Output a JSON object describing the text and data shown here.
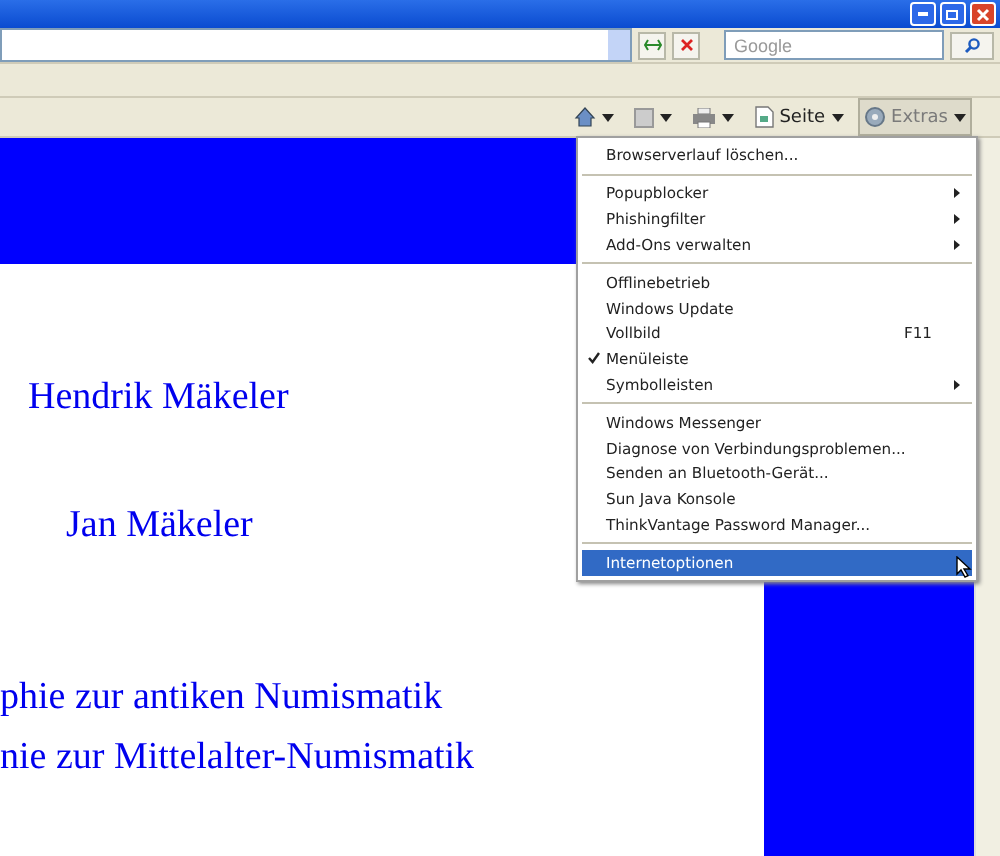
{
  "search": {
    "placeholder": "Google"
  },
  "command_bar": [
    {
      "kind": "home"
    },
    {
      "kind": "feeds"
    },
    {
      "kind": "print"
    },
    {
      "kind": "page",
      "label": "Seite"
    },
    {
      "kind": "tools",
      "label": "Extras"
    }
  ],
  "menu": [
    {
      "kind": "item",
      "label": "Browserverlauf löschen...",
      "submenu": false,
      "checked": false,
      "selected": false
    },
    {
      "kind": "separator"
    },
    {
      "kind": "item",
      "label": "Popupblocker",
      "submenu": true,
      "checked": false,
      "selected": false
    },
    {
      "kind": "item",
      "label": "Phishingfilter",
      "submenu": true,
      "checked": false,
      "selected": false
    },
    {
      "kind": "item",
      "label": "Add-Ons verwalten",
      "submenu": true,
      "checked": false,
      "selected": false
    },
    {
      "kind": "separator"
    },
    {
      "kind": "item",
      "label": "Offlinebetrieb",
      "submenu": false,
      "checked": false,
      "selected": false
    },
    {
      "kind": "item",
      "label": "Windows Update",
      "submenu": false,
      "checked": false,
      "selected": false
    },
    {
      "kind": "item",
      "label": "Vollbild",
      "shortcut": "F11",
      "submenu": false,
      "checked": false,
      "selected": false
    },
    {
      "kind": "item",
      "label": "Menüleiste",
      "submenu": false,
      "checked": true,
      "selected": false
    },
    {
      "kind": "item",
      "label": "Symbolleisten",
      "submenu": true,
      "checked": false,
      "selected": false
    },
    {
      "kind": "separator"
    },
    {
      "kind": "item",
      "label": "Windows Messenger",
      "submenu": false,
      "checked": false,
      "selected": false
    },
    {
      "kind": "item",
      "label": "Diagnose von Verbindungsproblemen...",
      "submenu": false,
      "checked": false,
      "selected": false
    },
    {
      "kind": "item",
      "label": "Senden an Bluetooth-Gerät...",
      "submenu": false,
      "checked": false,
      "selected": false
    },
    {
      "kind": "item",
      "label": "Sun Java Konsole",
      "submenu": false,
      "checked": false,
      "selected": false
    },
    {
      "kind": "item",
      "label": "ThinkVantage Password Manager...",
      "submenu": false,
      "checked": false,
      "selected": false
    },
    {
      "kind": "separator"
    },
    {
      "kind": "item",
      "label": "Internetoptionen",
      "submenu": false,
      "checked": false,
      "selected": true
    }
  ],
  "page": {
    "names": [
      "Hendrik Mäkeler",
      "Jan Mäkeler"
    ],
    "links": [
      "phie zur antiken Numismatik",
      "nie zur Mittelalter-Numismatik"
    ]
  }
}
